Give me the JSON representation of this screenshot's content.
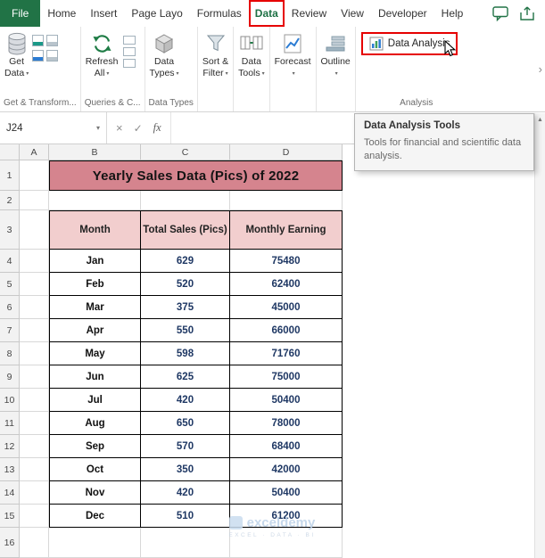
{
  "tab_bar": {
    "tabs": [
      {
        "label": "File",
        "type": "file"
      },
      {
        "label": "Home"
      },
      {
        "label": "Insert"
      },
      {
        "label": "Page Layo"
      },
      {
        "label": "Formulas"
      },
      {
        "label": "Data",
        "active": true,
        "highlighted": true
      },
      {
        "label": "Review"
      },
      {
        "label": "View"
      },
      {
        "label": "Developer"
      },
      {
        "label": "Help"
      }
    ]
  },
  "ribbon": {
    "groups": [
      {
        "label": "Get & Transform...",
        "buttons": [
          {
            "line1": "Get",
            "line2": "Data",
            "icon": "database-icon"
          }
        ]
      },
      {
        "label": "Queries & C...",
        "buttons": [
          {
            "line1": "Refresh",
            "line2": "All",
            "icon": "refresh-icon"
          }
        ]
      },
      {
        "label": "Data Types",
        "buttons": [
          {
            "line1": "Data",
            "line2": "Types",
            "icon": "cube-icon"
          }
        ]
      },
      {
        "label": "",
        "buttons": [
          {
            "line1": "Sort &",
            "line2": "Filter",
            "icon": "funnel-icon"
          }
        ]
      },
      {
        "label": "",
        "buttons": [
          {
            "line1": "Data",
            "line2": "Tools",
            "icon": "data-tools-icon"
          }
        ]
      },
      {
        "label": "",
        "buttons": [
          {
            "line1": "Forecast",
            "line2": "",
            "icon": "forecast-icon"
          }
        ]
      },
      {
        "label": "",
        "buttons": [
          {
            "line1": "Outline",
            "line2": "",
            "icon": "outline-icon"
          }
        ]
      }
    ],
    "analysis_group": {
      "label": "Analysis",
      "button_label": "Data Analysis"
    }
  },
  "formula_bar": {
    "name_box": "J24",
    "cancel_glyph": "×",
    "enter_glyph": "✓",
    "fx_label": "fx",
    "input_value": ""
  },
  "tooltip": {
    "title": "Data Analysis Tools",
    "body": "Tools for financial and scientific data analysis."
  },
  "sheet": {
    "columns": [
      "A",
      "B",
      "C",
      "D"
    ],
    "row_numbers": [
      "1",
      "2",
      "3",
      "4",
      "5",
      "6",
      "7",
      "8",
      "9",
      "10",
      "11",
      "12",
      "13",
      "14",
      "15",
      "16"
    ],
    "title": "Yearly Sales Data (Pics) of 2022",
    "table": {
      "headers": [
        "Month",
        "Total Sales (Pics)",
        "Monthly Earning"
      ],
      "rows": [
        [
          "Jan",
          "629",
          "75480"
        ],
        [
          "Feb",
          "520",
          "62400"
        ],
        [
          "Mar",
          "375",
          "45000"
        ],
        [
          "Apr",
          "550",
          "66000"
        ],
        [
          "May",
          "598",
          "71760"
        ],
        [
          "Jun",
          "625",
          "75000"
        ],
        [
          "Jul",
          "420",
          "50400"
        ],
        [
          "Aug",
          "650",
          "78000"
        ],
        [
          "Sep",
          "570",
          "68400"
        ],
        [
          "Oct",
          "350",
          "42000"
        ],
        [
          "Nov",
          "420",
          "50400"
        ],
        [
          "Dec",
          "510",
          "61200"
        ]
      ]
    }
  },
  "watermark": {
    "brand": "exceldemy",
    "tagline": "EXCEL · DATA · BI"
  },
  "scrollbar": {
    "up_glyph": "▲"
  },
  "ribbon_more_glyph": "›",
  "colors": {
    "excel_green": "#217346",
    "highlight_red": "#e60000",
    "title_fill": "#d5848e",
    "header_fill": "#f2cece",
    "number_text": "#1f3864"
  }
}
